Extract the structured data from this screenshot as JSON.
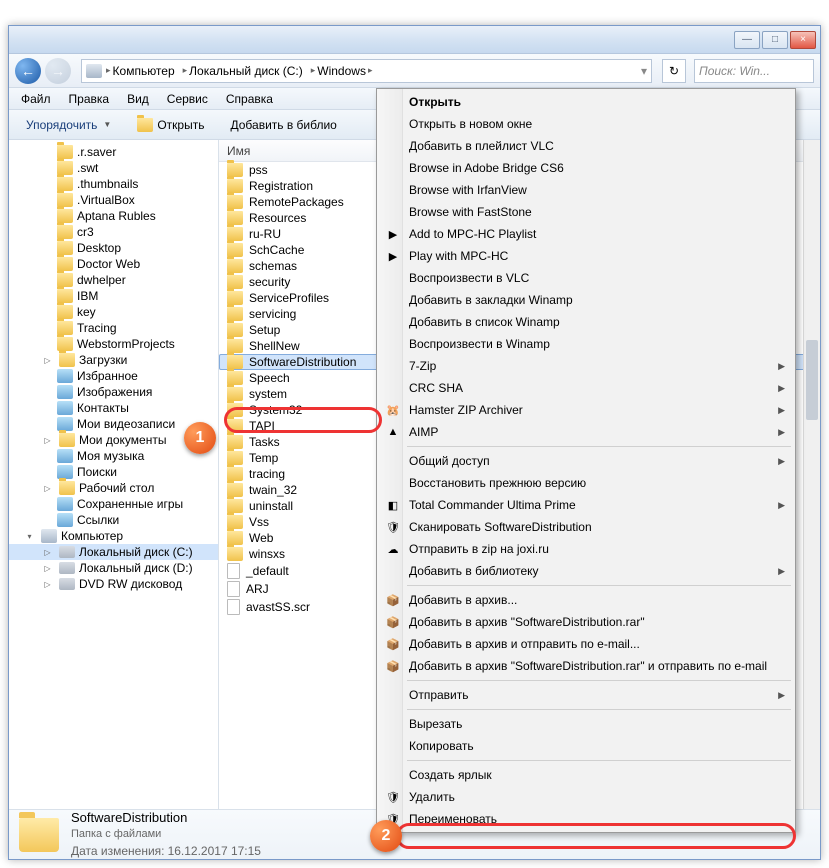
{
  "title_buttons": {
    "min": "—",
    "max": "□",
    "close": "×"
  },
  "nav": {
    "back": "←",
    "fwd": "→"
  },
  "breadcrumb": [
    {
      "label": "Компьютер"
    },
    {
      "label": "Локальный диск (C:)"
    },
    {
      "label": "Windows"
    }
  ],
  "search_placeholder": "Поиск: Win...",
  "refresh_icon": "↻",
  "menubar": [
    "Файл",
    "Правка",
    "Вид",
    "Сервис",
    "Справка"
  ],
  "toolbar": {
    "organize": "Упорядочить",
    "open": "Открыть",
    "add_library": "Добавить в библио"
  },
  "tree": [
    {
      "label": ".r.saver",
      "lvl": "l1"
    },
    {
      "label": ".swt",
      "lvl": "l1"
    },
    {
      "label": ".thumbnails",
      "lvl": "l1"
    },
    {
      "label": ".VirtualBox",
      "lvl": "l1"
    },
    {
      "label": "Aptana Rubles",
      "lvl": "l1"
    },
    {
      "label": "cr3",
      "lvl": "l1"
    },
    {
      "label": "Desktop",
      "lvl": "l1"
    },
    {
      "label": "Doctor Web",
      "lvl": "l1"
    },
    {
      "label": "dwhelper",
      "lvl": "l1"
    },
    {
      "label": "IBM",
      "lvl": "l1"
    },
    {
      "label": "key",
      "lvl": "l1"
    },
    {
      "label": "Tracing",
      "lvl": "l1"
    },
    {
      "label": "WebstormProjects",
      "lvl": "l1"
    },
    {
      "label": "Загрузки",
      "lvl": "l1",
      "exp": "▷"
    },
    {
      "label": "Избранное",
      "lvl": "l1",
      "lib": true
    },
    {
      "label": "Изображения",
      "lvl": "l1",
      "lib": true
    },
    {
      "label": "Контакты",
      "lvl": "l1",
      "lib": true
    },
    {
      "label": "Мои видеозаписи",
      "lvl": "l1",
      "lib": true
    },
    {
      "label": "Мои документы",
      "lvl": "l1",
      "exp": "▷"
    },
    {
      "label": "Моя музыка",
      "lvl": "l1",
      "lib": true
    },
    {
      "label": "Поиски",
      "lvl": "l1",
      "lib": true
    },
    {
      "label": "Рабочий стол",
      "lvl": "l1",
      "exp": "▷"
    },
    {
      "label": "Сохраненные игры",
      "lvl": "l1",
      "lib": true
    },
    {
      "label": "Ссылки",
      "lvl": "l1",
      "lib": true
    }
  ],
  "tree_computer": {
    "label": "Компьютер"
  },
  "tree_drives": [
    {
      "label": "Локальный диск (C:)",
      "sel": true
    },
    {
      "label": "Локальный диск (D:)"
    },
    {
      "label": "DVD RW дисковод"
    }
  ],
  "list_header": "Имя",
  "files": [
    {
      "name": "pss"
    },
    {
      "name": "Registration"
    },
    {
      "name": "RemotePackages"
    },
    {
      "name": "Resources"
    },
    {
      "name": "ru-RU"
    },
    {
      "name": "SchCache"
    },
    {
      "name": "schemas"
    },
    {
      "name": "security"
    },
    {
      "name": "ServiceProfiles"
    },
    {
      "name": "servicing"
    },
    {
      "name": "Setup"
    },
    {
      "name": "ShellNew"
    },
    {
      "name": "SoftwareDistribution",
      "selected": true
    },
    {
      "name": "Speech"
    },
    {
      "name": "system"
    },
    {
      "name": "System32"
    },
    {
      "name": "TAPI"
    },
    {
      "name": "Tasks"
    },
    {
      "name": "Temp"
    },
    {
      "name": "tracing"
    },
    {
      "name": "twain_32"
    },
    {
      "name": "uninstall"
    },
    {
      "name": "Vss"
    },
    {
      "name": "Web"
    },
    {
      "name": "winsxs"
    },
    {
      "name": "_default",
      "file": true
    },
    {
      "name": "ARJ",
      "file": true
    },
    {
      "name": "avastSS.scr",
      "file": true
    }
  ],
  "details": {
    "name": "SoftwareDistribution",
    "type": "Папка с файлами",
    "date_label": "Дата изменения:",
    "date": "16.12.2017 17:15"
  },
  "context": [
    {
      "t": "Открыть",
      "bold": true
    },
    {
      "t": "Открыть в новом окне"
    },
    {
      "t": "Добавить в плейлист VLC"
    },
    {
      "t": "Browse in Adobe Bridge CS6"
    },
    {
      "t": "Browse with IrfanView"
    },
    {
      "t": "Browse with FastStone"
    },
    {
      "t": "Add to MPC-HC Playlist",
      "ico": "▶"
    },
    {
      "t": "Play with MPC-HC",
      "ico": "▶"
    },
    {
      "t": "Воспроизвести в VLC"
    },
    {
      "t": "Добавить в закладки Winamp"
    },
    {
      "t": "Добавить в список Winamp"
    },
    {
      "t": "Воспроизвести в Winamp"
    },
    {
      "t": "7-Zip",
      "sub": "▶"
    },
    {
      "t": "CRC SHA",
      "sub": "▶"
    },
    {
      "t": "Hamster ZIP Archiver",
      "ico": "🐹",
      "sub": "▶"
    },
    {
      "t": "AIMP",
      "ico": "▲",
      "sub": "▶"
    },
    {
      "sep": true
    },
    {
      "t": "Общий доступ",
      "sub": "▶"
    },
    {
      "t": "Восстановить прежнюю версию"
    },
    {
      "t": "Total Commander Ultima Prime",
      "ico": "◧",
      "sub": "▶"
    },
    {
      "t": "Сканировать SoftwareDistribution",
      "ico": "🛡"
    },
    {
      "t": "Отправить в zip на joxi.ru",
      "ico": "☁"
    },
    {
      "t": "Добавить в библиотеку",
      "sub": "▶"
    },
    {
      "sep": true
    },
    {
      "t": "Добавить в архив...",
      "ico": "📦"
    },
    {
      "t": "Добавить в архив \"SoftwareDistribution.rar\"",
      "ico": "📦"
    },
    {
      "t": "Добавить в архив и отправить по e-mail...",
      "ico": "📦"
    },
    {
      "t": "Добавить в архив \"SoftwareDistribution.rar\" и отправить по e-mail",
      "ico": "📦"
    },
    {
      "sep": true
    },
    {
      "t": "Отправить",
      "sub": "▶"
    },
    {
      "sep": true
    },
    {
      "t": "Вырезать"
    },
    {
      "t": "Копировать"
    },
    {
      "sep": true
    },
    {
      "t": "Создать ярлык"
    },
    {
      "t": "Удалить",
      "ico": "🛡"
    },
    {
      "t": "Переименовать",
      "ico": "🛡",
      "highlight": true
    }
  ],
  "badges": {
    "one": "1",
    "two": "2"
  }
}
